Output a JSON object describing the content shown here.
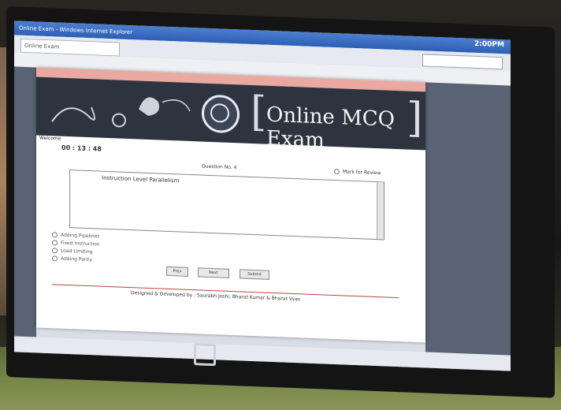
{
  "browser": {
    "window_title": "Online Exam - Windows Internet Explorer",
    "tab_label": "Online Exam",
    "clock": "2:00PM"
  },
  "exam": {
    "title": "Online MCQ Exam",
    "welcome": "Welcome",
    "timer": "00 : 13 : 48",
    "question_number": "Question No. 4",
    "mark_review": "Mark for Review",
    "question_text": "Instruction Level Parallelism",
    "options": [
      "Adding Pipelines",
      "Fixed Instruction",
      "Load Limiting",
      "Adding Parity"
    ],
    "buttons": [
      "Prev",
      "Next",
      "Submit"
    ],
    "footer": "Designed & Developed by : Saurabh Joshi, Bharat Kumar & Bharat Vyas"
  },
  "device": {
    "logo": "compaq-logo-icon"
  },
  "colors": {
    "frame": "#c9524d",
    "banner": "#2d3440",
    "pinkbar": "#e9a8a0"
  }
}
